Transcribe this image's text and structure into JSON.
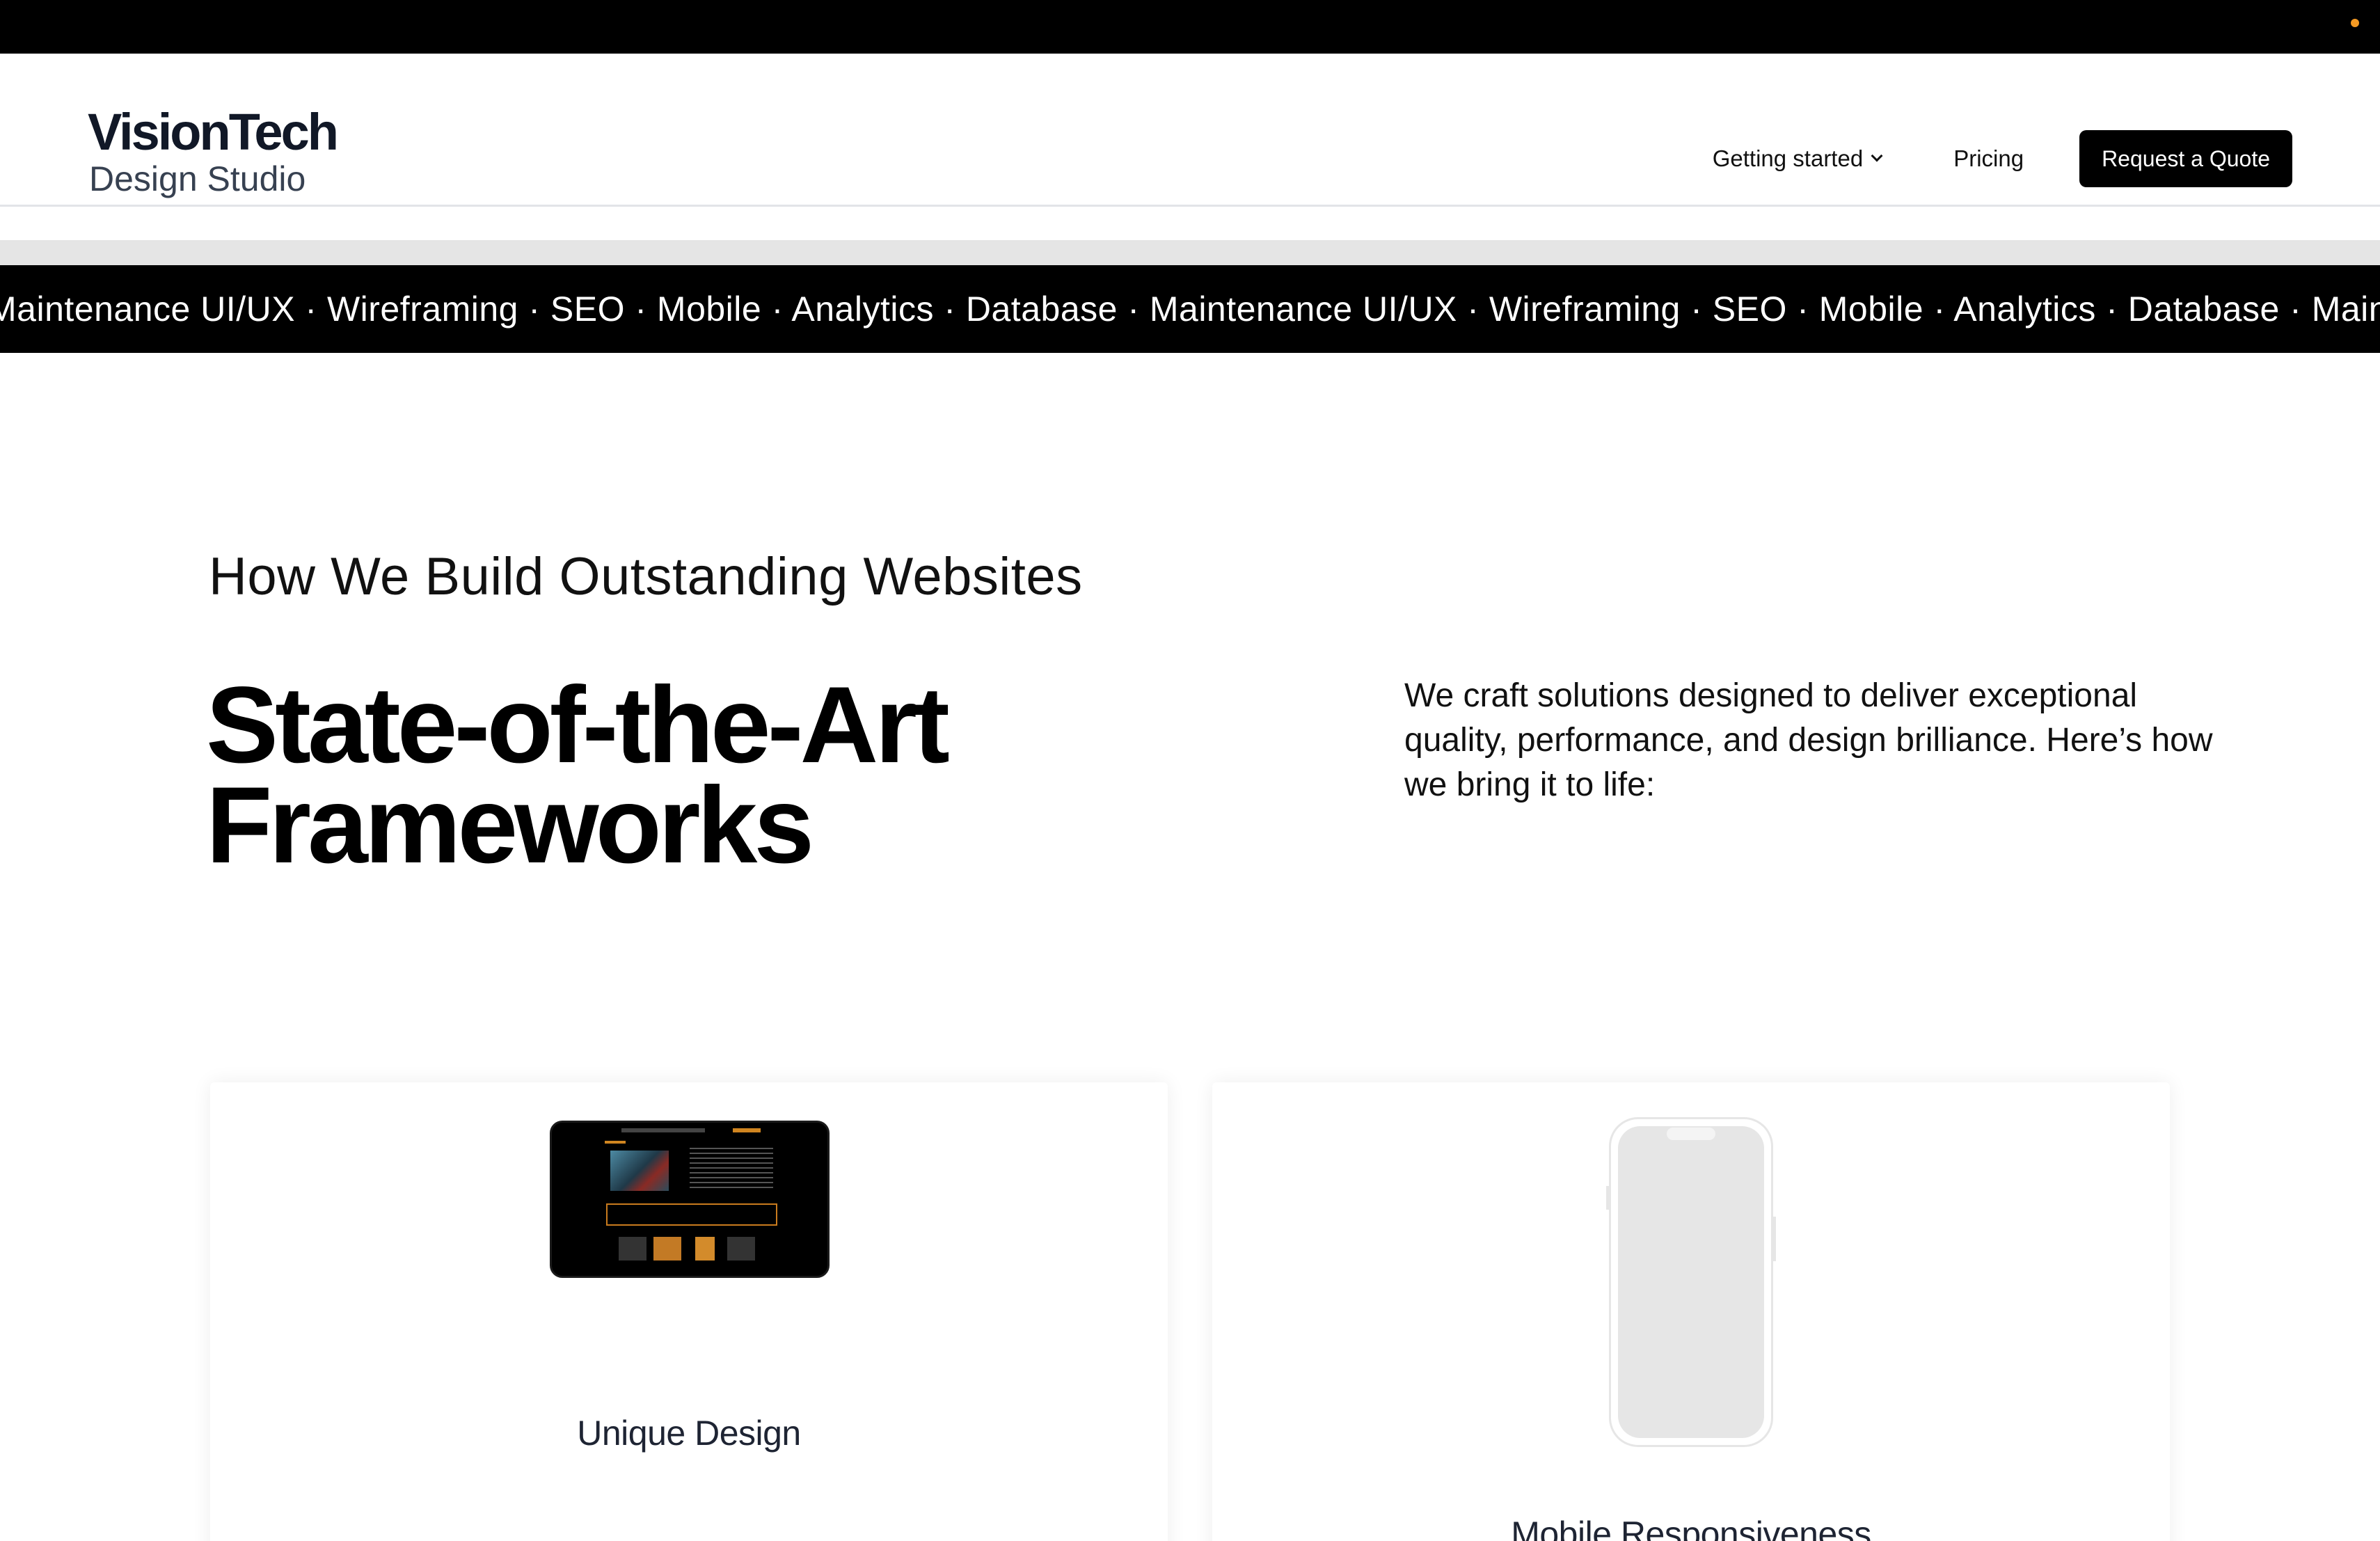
{
  "header": {
    "brand": "VisionTech",
    "brand_sub": "Design Studio",
    "nav": {
      "getting_started": "Getting started",
      "pricing": "Pricing",
      "cta": "Request a Quote"
    }
  },
  "ticker": {
    "text": "Maintenance UI/UX · Wireframing · SEO · Mobile · Analytics · Database · Maintenance UI/UX · Wireframing · SEO · Mobile · Analytics · Database · Maintenance"
  },
  "section": {
    "eyebrow": "How We Build Outstanding Websites",
    "headline_line1": "State-of-the-Art",
    "headline_line2": "Frameworks",
    "intro": "We craft solutions designed to deliver exceptional quality, performance, and design brilliance. Here’s how we bring it to life:"
  },
  "cards": [
    {
      "title": "Unique Design"
    },
    {
      "title": "Mobile Responsiveness"
    }
  ],
  "colors": {
    "accent_dot": "#f59a23",
    "ticker_bg": "#000000",
    "cta_bg": "#000000"
  }
}
